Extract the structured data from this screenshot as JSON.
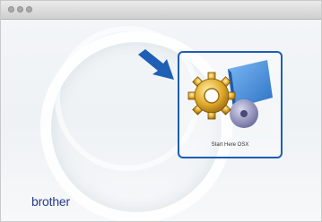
{
  "window": {
    "title": ""
  },
  "installer": {
    "icon_caption": "Start Here OSX"
  },
  "brand": {
    "logo_text": "brother"
  }
}
